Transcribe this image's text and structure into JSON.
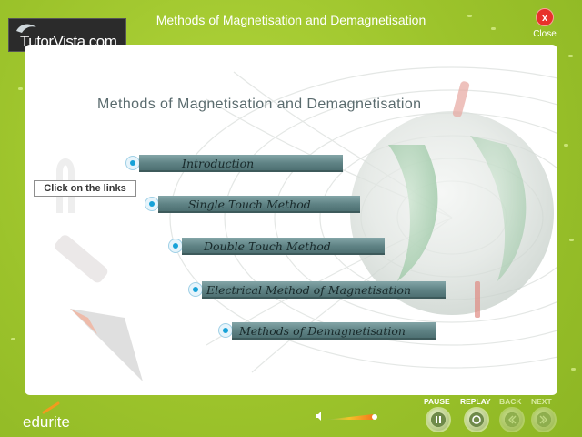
{
  "header": {
    "logo_text": "TutorVista.com",
    "title": "Methods of Magnetisation and Demagnetisation",
    "close_symbol": "x",
    "close_label": "Close"
  },
  "panel": {
    "heading": "Methods of Magnetisation and Demagnetisation",
    "hint": "Click on the links",
    "links": [
      {
        "label": "Introduction"
      },
      {
        "label": "Single Touch Method"
      },
      {
        "label": "Double Touch Method"
      },
      {
        "label": "Electrical Method of Magnetisation"
      },
      {
        "label": "Methods of Demagnetisation"
      }
    ]
  },
  "footer": {
    "brand": "edurite",
    "controls": [
      {
        "label": "PAUSE",
        "enabled": true,
        "icon": "pause-icon"
      },
      {
        "label": "REPLAY",
        "enabled": true,
        "icon": "replay-icon"
      },
      {
        "label": "BACK",
        "enabled": false,
        "icon": "back-icon"
      },
      {
        "label": "NEXT",
        "enabled": false,
        "icon": "next-icon"
      }
    ],
    "volume_icon": "speaker-icon",
    "volume_level": 0.9
  },
  "colors": {
    "background": "#9ac22a",
    "close": "#e8312a",
    "link_bar": "#5e8284",
    "bullet": "#17a2d8"
  }
}
